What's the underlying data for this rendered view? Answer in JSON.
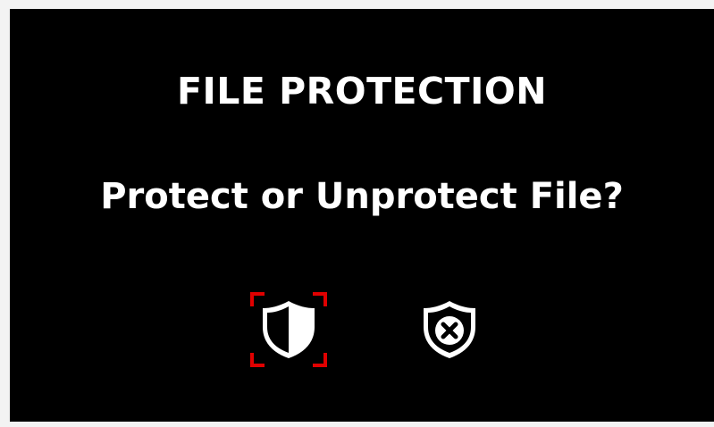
{
  "dialog": {
    "title": "FILE PROTECTION",
    "question": "Protect or Unprotect File?"
  },
  "options": [
    {
      "id": "protect",
      "icon": "half-filled-shield-icon",
      "selected": true
    },
    {
      "id": "unprotect",
      "icon": "shield-x-icon",
      "selected": false
    }
  ],
  "colors": {
    "background": "#000000",
    "text": "#ffffff",
    "selection": "#e00000"
  }
}
